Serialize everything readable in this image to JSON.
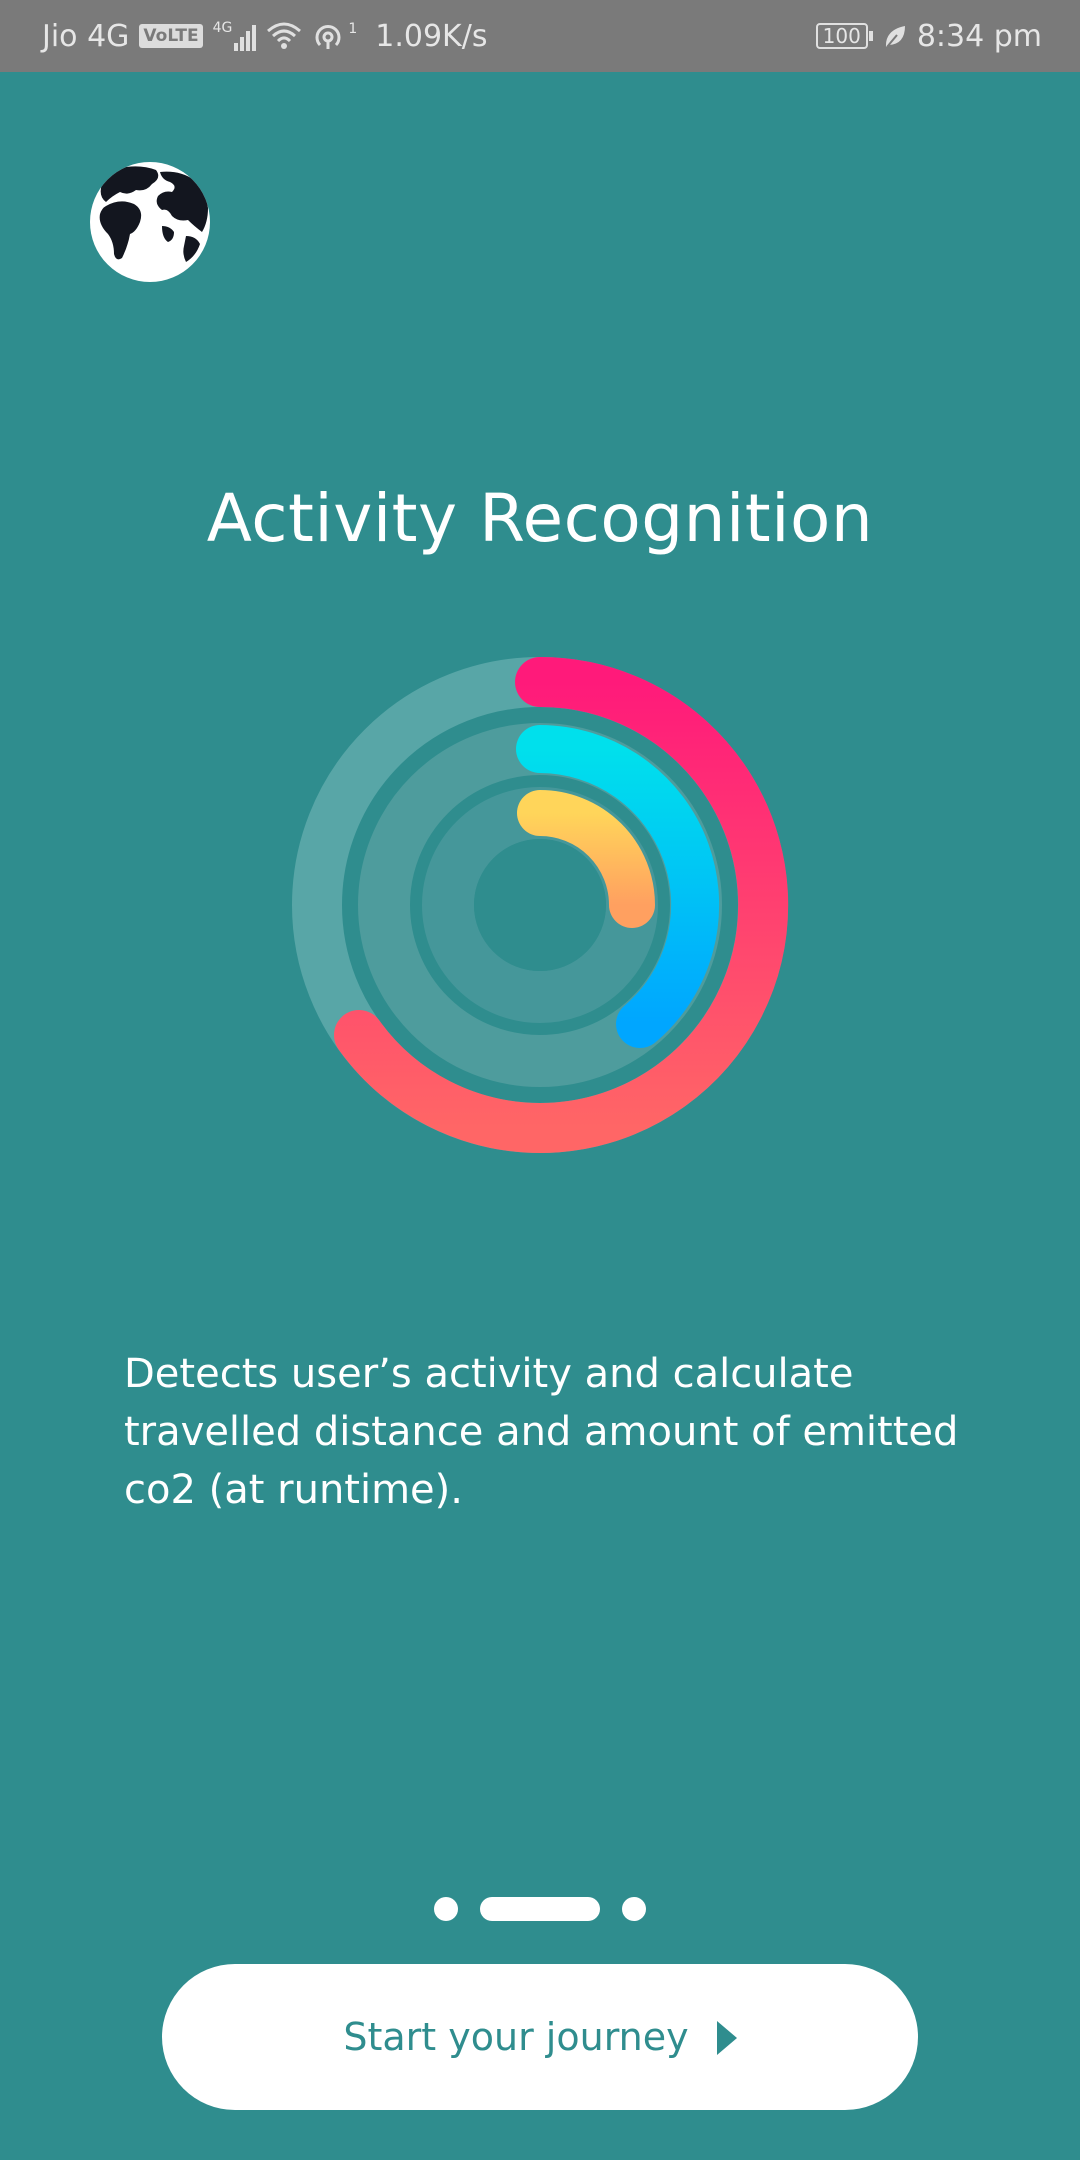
{
  "status_bar": {
    "carrier": "Jio 4G",
    "volte": "VoLTE",
    "network_type": "4G",
    "hotspot_count": "1",
    "speed": "1.09K/s",
    "battery": "100",
    "time": "8:34 pm"
  },
  "header": {
    "logo_icon": "globe-icon"
  },
  "onboarding": {
    "title": "Activity Recognition",
    "description": "Detects user’s activity and calculate travelled distance and amount of emitted co2 (at runtime).",
    "illustration": "activity-rings-icon",
    "page_index": 2,
    "page_count": 3
  },
  "actions": {
    "start_label": "Start your journey",
    "start_icon": "play-arrow-icon"
  },
  "colors": {
    "background": "#2f8d8e",
    "ring_outer": [
      "#ff1a7a",
      "#ff6666"
    ],
    "ring_middle": [
      "#00e0ec",
      "#00a6ff"
    ],
    "ring_inner": [
      "#ffd55a",
      "#ffa060"
    ]
  }
}
